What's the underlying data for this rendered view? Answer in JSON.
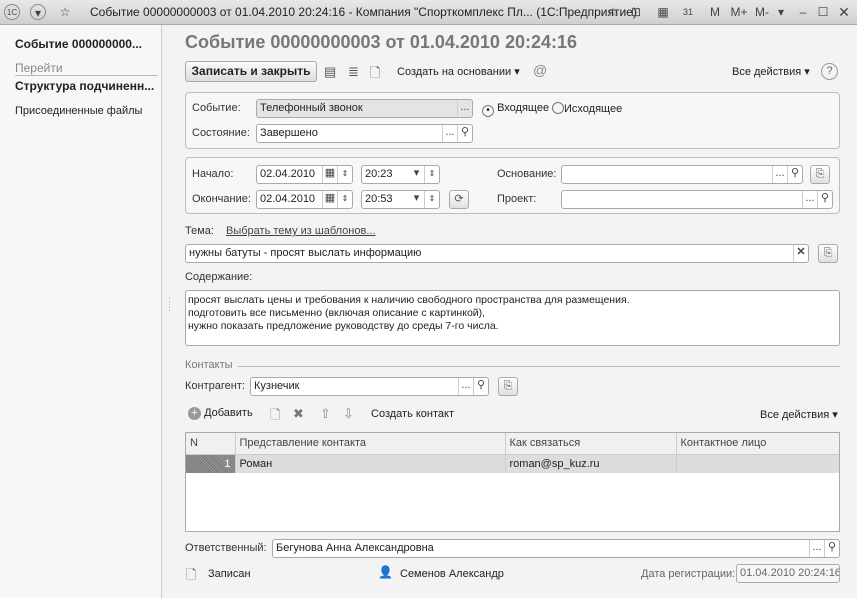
{
  "window": {
    "title": "Событие 00000000003 от 01.04.2010 20:24:16 - Компания \"Спорткомплекс Пл... (1С:Предприятие)",
    "m": "M",
    "mplus": "M+",
    "mminus": "M-"
  },
  "sidebar": {
    "doc": "Событие 000000000...",
    "goto": "Перейти",
    "items": [
      "Структура подчиненн...",
      "Присоединенные файлы"
    ]
  },
  "header": {
    "title": "Событие 00000000003 от 01.04.2010 20:24:16"
  },
  "toolbar": {
    "save_close": "Записать и закрыть",
    "create_based": "Создать на основании",
    "all_actions": "Все действия",
    "help": "?",
    "at": "@"
  },
  "form": {
    "event_label": "Событие:",
    "event_value": "Телефонный звонок",
    "dots": "...",
    "incoming": "Входящее",
    "outgoing": "Исходящее",
    "direction": "incoming",
    "state_label": "Состояние:",
    "state_value": "Завершено",
    "start_label": "Начало:",
    "start_date": "02.04.2010",
    "start_time": "20:23",
    "end_label": "Окончание:",
    "end_date": "02.04.2010",
    "end_time": "20:53",
    "basis_label": "Основание:",
    "basis_value": "",
    "project_label": "Проект:",
    "project_value": "",
    "topic_label": "Тема:",
    "topic_link": "Выбрать тему из шаблонов...",
    "topic_value": "нужны батуты - просят выслать информацию",
    "content_label": "Содержание:",
    "content_lines": [
      "просят выслать цены и требования к наличию свободного пространства для размещения.",
      "подготовить все письменно (включая описание с картинкой),",
      "нужно показать предложение руководству до среды 7-го числа."
    ],
    "contacts_group": "Контакты",
    "counterparty_label": "Контрагент:",
    "counterparty_value": "Кузнечик",
    "responsible_label": "Ответственный:",
    "responsible_value": "Бегунова Анна Александровна"
  },
  "contacts_toolbar": {
    "add": "Добавить",
    "create_contact": "Создать контакт",
    "all_actions": "Все действия"
  },
  "contacts_table": {
    "columns": [
      "N",
      "Представление контакта",
      "Как связаться",
      "Контактное лицо"
    ],
    "rows": [
      {
        "n": "1",
        "name": "Роман",
        "how": "roman@sp_kuz.ru",
        "person": ""
      }
    ]
  },
  "footer": {
    "status": "Записан",
    "author": "Семенов Александр",
    "reg_label": "Дата регистрации:",
    "reg_value": "01.04.2010 20:24:16"
  }
}
